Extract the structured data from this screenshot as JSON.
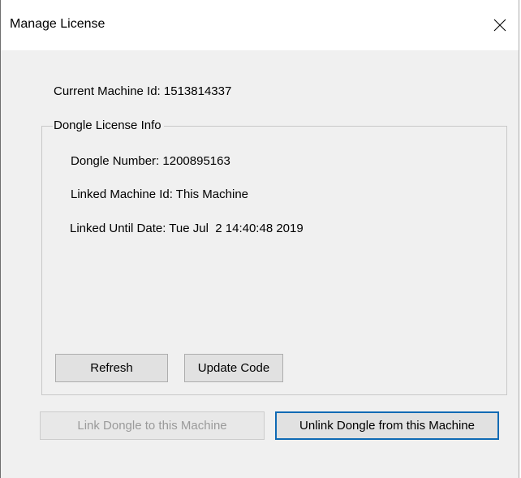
{
  "window": {
    "title": "Manage License"
  },
  "icons": {
    "close": "close-icon"
  },
  "machine": {
    "current_machine_id": "Current Machine Id: 1513814337"
  },
  "dongle_group": {
    "title": "Dongle License Info",
    "dongle_number": "Dongle Number: 1200895163",
    "linked_machine_id": "Linked Machine Id: This Machine",
    "linked_until_date": "Linked Until Date: Tue Jul  2 14:40:48 2019",
    "refresh_label": "Refresh",
    "update_code_label": "Update Code"
  },
  "actions": {
    "link_label": "Link Dongle to this Machine",
    "link_enabled": false,
    "unlink_label": "Unlink Dongle from this Machine"
  }
}
